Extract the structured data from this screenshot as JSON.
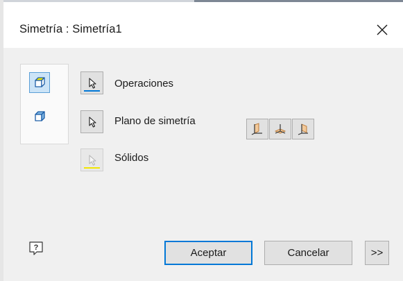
{
  "window": {
    "title": "Simetría : Simetría1",
    "close_icon": "close-icon"
  },
  "side_panel": {
    "items": [
      {
        "icon": "mirror-features-icon",
        "selected": true
      },
      {
        "icon": "mirror-solids-icon",
        "selected": false
      }
    ]
  },
  "selectors": {
    "operaciones": {
      "label": "Operaciones",
      "underline_color": "#0078d7",
      "icon": "select-arrow-icon"
    },
    "plano": {
      "label": "Plano de simetría",
      "icon": "select-arrow-icon"
    },
    "solidos": {
      "label": "Sólidos",
      "underline_color": "#f2e600",
      "icon": "select-arrow-icon",
      "enabled": false
    }
  },
  "plane_buttons": [
    {
      "icon": "plane-yz-icon"
    },
    {
      "icon": "plane-xz-icon"
    },
    {
      "icon": "plane-xy-icon"
    }
  ],
  "footer": {
    "help_icon": "help-icon",
    "ok_label": "Aceptar",
    "cancel_label": "Cancelar",
    "more_label": ">>"
  },
  "colors": {
    "accent": "#0078d7",
    "selected_bg": "#cce4f7",
    "solids_underline": "#f2e600"
  }
}
